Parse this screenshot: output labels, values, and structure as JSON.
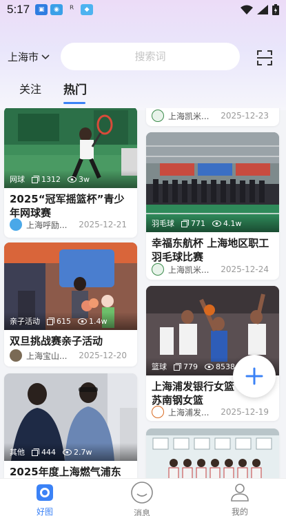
{
  "status_bar": {
    "time": "5:17"
  },
  "header": {
    "city": "上海市",
    "search_placeholder": "搜索词"
  },
  "tabs": [
    {
      "label": "关注",
      "active": false
    },
    {
      "label": "热门",
      "active": true
    }
  ],
  "cards": [
    {
      "id": "tennis",
      "category": "网球",
      "photos": "1312",
      "views": "3w",
      "title": "2025“冠军摇篮杯”青少年网球赛",
      "author": "上海呼励...",
      "date": "2025-12-21"
    },
    {
      "id": "family",
      "category": "亲子活动",
      "photos": "615",
      "views": "1.4w",
      "title": "双旦挑战赛亲子活动",
      "author": "上海宝山...",
      "date": "2025-12-20"
    },
    {
      "id": "gas",
      "category": "其他",
      "photos": "444",
      "views": "2.7w",
      "title": "2025年度上海燃气浦东",
      "author": "",
      "date": ""
    },
    {
      "id": "top-partial",
      "category": "",
      "photos": "",
      "views": "",
      "title": "",
      "author": "上海凯米...",
      "date": "2025-12-23"
    },
    {
      "id": "badminton",
      "category": "羽毛球",
      "photos": "771",
      "views": "4.1w",
      "title": "幸福东航杯 上海地区职工羽毛球比赛",
      "author": "上海凯米...",
      "date": "2025-12-24"
    },
    {
      "id": "basketball",
      "category": "篮球",
      "photos": "779",
      "views": "8538",
      "title": "上海浦发银行女篮 VS 江苏南钢女篮",
      "author": "上海浦发...",
      "date": "2025-12-19"
    }
  ],
  "bottom_nav": [
    {
      "label": "好图",
      "icon": "camera-icon",
      "active": true
    },
    {
      "label": "消息",
      "icon": "message-icon",
      "active": false
    },
    {
      "label": "我的",
      "icon": "user-icon",
      "active": false
    }
  ],
  "colors": {
    "accent": "#3b82f6",
    "background": "#f3f4f7"
  }
}
